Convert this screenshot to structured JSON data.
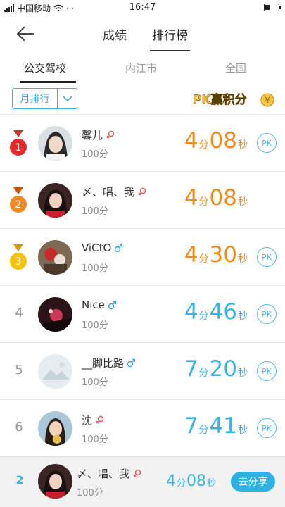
{
  "status_bar": {
    "carrier": "中国移动",
    "dots": "···",
    "time": "16:47"
  },
  "header": {
    "back_icon": "arrow-left-icon",
    "tabs": [
      {
        "label": "成绩"
      },
      {
        "label": "排行榜"
      }
    ],
    "active_tab": "排行榜"
  },
  "subtabs": [
    {
      "label": "公交驾校"
    },
    {
      "label": "内江市"
    },
    {
      "label": "全国"
    }
  ],
  "filter": {
    "month_select": "月排行",
    "pk_banner": "PK赢积分"
  },
  "colors": {
    "accent": "#3ab5e3",
    "gold_time": "#f08c1e",
    "blue_time": "#3cb4e0",
    "female": "#e5555f",
    "male": "#3aa6df"
  },
  "ranking": [
    {
      "rank": "1",
      "name": "馨儿",
      "gender": "female",
      "points": "100分",
      "min": "4",
      "min_unit": "分",
      "sec": "08",
      "sec_unit": "秒",
      "pk": "PK",
      "has_pk": true
    },
    {
      "rank": "2",
      "name": "〆、唱、我",
      "gender": "female",
      "points": "100分",
      "min": "4",
      "min_unit": "分",
      "sec": "08",
      "sec_unit": "秒",
      "pk": "",
      "has_pk": false
    },
    {
      "rank": "3",
      "name": "ViCtO",
      "gender": "male",
      "points": "100分",
      "min": "4",
      "min_unit": "分",
      "sec": "30",
      "sec_unit": "秒",
      "pk": "PK",
      "has_pk": true
    },
    {
      "rank": "4",
      "name": "Nice",
      "gender": "male",
      "points": "100分",
      "min": "4",
      "min_unit": "分",
      "sec": "46",
      "sec_unit": "秒",
      "pk": "PK",
      "has_pk": true
    },
    {
      "rank": "5",
      "name": "__脚比路",
      "gender": "male",
      "points": "100分",
      "min": "7",
      "min_unit": "分",
      "sec": "20",
      "sec_unit": "秒",
      "pk": "PK",
      "has_pk": true
    },
    {
      "rank": "6",
      "name": "沈",
      "gender": "female",
      "points": "100分",
      "min": "7",
      "min_unit": "分",
      "sec": "41",
      "sec_unit": "秒",
      "pk": "PK",
      "has_pk": true
    }
  ],
  "my_rank": {
    "rank": "2",
    "name": "〆、唱、我",
    "gender": "female",
    "points": "100分",
    "min": "4",
    "min_unit": "分",
    "sec": "08",
    "sec_unit": "秒",
    "share_label": "去分享"
  }
}
